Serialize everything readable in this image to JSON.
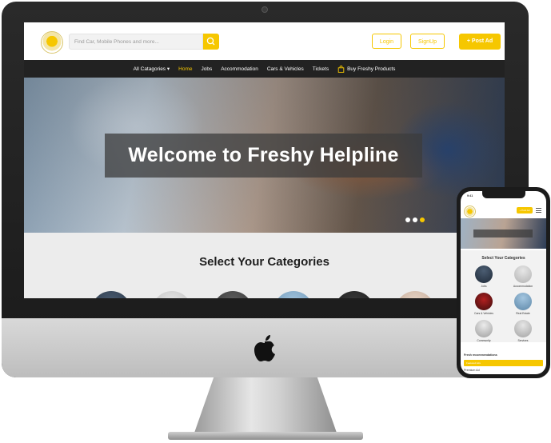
{
  "site": {
    "search": {
      "placeholder": "Find Car, Mobile Phones and more..."
    },
    "buttons": {
      "login": "Login",
      "signup": "SignUp",
      "post_ad": "+ Post Ad"
    },
    "nav": [
      {
        "label": "All Catagories ▾",
        "active": false
      },
      {
        "label": "Home",
        "active": true
      },
      {
        "label": "Jobs",
        "active": false
      },
      {
        "label": "Accommodation",
        "active": false
      },
      {
        "label": "Cars & Vehicles",
        "active": false
      },
      {
        "label": "Tickets",
        "active": false
      },
      {
        "label": "Buy Freshy Products",
        "active": false
      }
    ],
    "hero": {
      "title": "Welcome to Freshy Helpline",
      "slides": 3,
      "active_slide": 3
    },
    "categories_title": "Select Your Categories"
  },
  "phone": {
    "status_time": "9:41",
    "post_ad": "+ Post Ad",
    "categories_title": "Select Your Categories",
    "categories": [
      "Jobs",
      "Accommodation",
      "Cars & Vehicles",
      "Real Estate",
      "Community",
      "Services"
    ],
    "section_title": "Fresh recommendations",
    "featured": "Featured Ads",
    "recent": "Premium Ad"
  },
  "colors": {
    "accent": "#f6c700",
    "navbar": "#222222",
    "text": "#1e1e1e"
  }
}
